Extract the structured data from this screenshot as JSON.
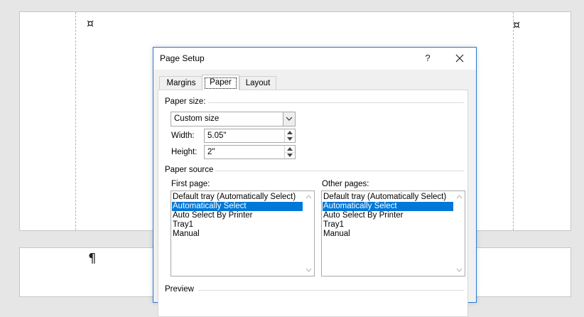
{
  "document": {
    "pages": [
      {
        "marks": [
          "¤",
          "¤"
        ]
      },
      {
        "marks": [
          "¶"
        ]
      }
    ]
  },
  "dialog": {
    "title": "Page Setup",
    "help_label": "?",
    "close_icon": "close-icon",
    "tabs": [
      {
        "label": "Margins",
        "selected": false
      },
      {
        "label": "Paper",
        "selected": true
      },
      {
        "label": "Layout",
        "selected": false
      }
    ],
    "paper_size": {
      "group_label": "Paper size:",
      "selected_option": "Custom size",
      "width_label": "Width:",
      "width_value": "5.05\"",
      "height_label": "Height:",
      "height_value": "2\""
    },
    "paper_source": {
      "group_label": "Paper source",
      "first_page": {
        "label": "First page:",
        "items": [
          {
            "text": "Default tray (Automatically Select)",
            "selected": false
          },
          {
            "text": "Automatically Select",
            "selected": true
          },
          {
            "text": "Auto Select By Printer",
            "selected": false
          },
          {
            "text": "Tray1",
            "selected": false
          },
          {
            "text": "Manual",
            "selected": false
          }
        ]
      },
      "other_pages": {
        "label": "Other pages:",
        "items": [
          {
            "text": "Default tray (Automatically Select)",
            "selected": false
          },
          {
            "text": "Automatically Select",
            "selected": true
          },
          {
            "text": "Auto Select By Printer",
            "selected": false
          },
          {
            "text": "Tray1",
            "selected": false
          },
          {
            "text": "Manual",
            "selected": false
          }
        ]
      }
    },
    "preview_label": "Preview"
  },
  "colors": {
    "dialog_border": "#2b79d7",
    "selection": "#0078d7",
    "background": "#e6e6e6"
  }
}
